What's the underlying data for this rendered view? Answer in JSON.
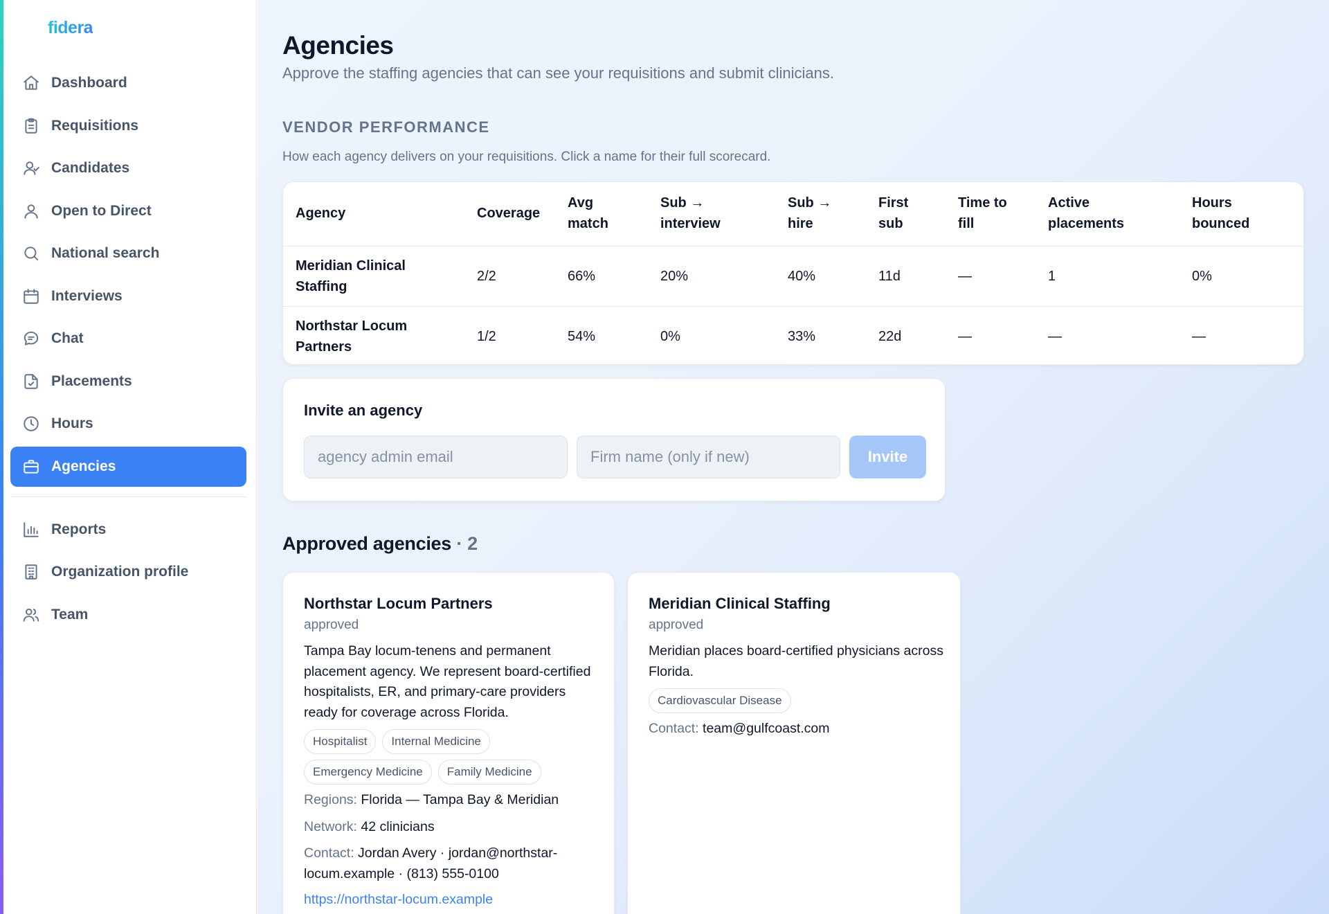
{
  "app": {
    "logo": "fidera"
  },
  "sidebar": {
    "items": [
      {
        "label": "Dashboard",
        "icon": "home-icon",
        "active": false
      },
      {
        "label": "Requisitions",
        "icon": "clipboard-icon",
        "active": false
      },
      {
        "label": "Candidates",
        "icon": "user-check-icon",
        "active": false
      },
      {
        "label": "Open to Direct",
        "icon": "user-icon",
        "active": false
      },
      {
        "label": "National search",
        "icon": "search-icon",
        "active": false
      },
      {
        "label": "Interviews",
        "icon": "calendar-icon",
        "active": false
      },
      {
        "label": "Chat",
        "icon": "chat-icon",
        "active": false
      },
      {
        "label": "Placements",
        "icon": "file-check-icon",
        "active": false
      },
      {
        "label": "Hours",
        "icon": "clock-icon",
        "active": false
      },
      {
        "label": "Agencies",
        "icon": "briefcase-icon",
        "active": true
      }
    ],
    "secondary_items": [
      {
        "label": "Reports",
        "icon": "bar-chart-icon"
      },
      {
        "label": "Organization profile",
        "icon": "building-icon"
      },
      {
        "label": "Team",
        "icon": "users-icon"
      }
    ]
  },
  "page": {
    "title": "Agencies",
    "subtitle": "Approve the staffing agencies that can see your requisitions and submit clinicians."
  },
  "vendor_performance": {
    "label": "VENDOR PERFORMANCE",
    "description": "How each agency delivers on your requisitions. Click a name for their full scorecard.",
    "headers": [
      "Agency",
      "Coverage",
      "Avg match",
      "Sub → interview",
      "Sub → hire",
      "First sub",
      "Time to fill",
      "Active placements",
      "Hours bounced"
    ],
    "rows": [
      [
        "Meridian Clinical Staffing",
        "2/2",
        "66%",
        "20%",
        "40%",
        "11d",
        "—",
        "1",
        "0%"
      ],
      [
        "Northstar Locum Partners",
        "1/2",
        "54%",
        "0%",
        "33%",
        "22d",
        "—",
        "—",
        "—"
      ]
    ]
  },
  "invite": {
    "title": "Invite an agency",
    "email_placeholder": "agency admin email",
    "email_value": "",
    "firm_placeholder": "Firm name (only if new)",
    "firm_value": "",
    "button_label": "Invite"
  },
  "approved": {
    "heading": "Approved agencies",
    "count": "· 2",
    "cards": [
      {
        "name": "Northstar Locum Partners",
        "status": "approved",
        "description": "Tampa Bay locum-tenens and permanent placement agency. We represent board-certified hospitalists, ER, and primary-care providers ready for coverage across Florida.",
        "tags": [
          "Hospitalist",
          "Internal Medicine",
          "Emergency Medicine",
          "Family Medicine"
        ],
        "regions_label": "Regions:",
        "regions": "Florida — Tampa Bay & Meridian",
        "network_label": "Network:",
        "network": "42 clinicians",
        "contact_label": "Contact:",
        "contact": "Jordan Avery · jordan@northstar-locum.example · (813) 555-0100",
        "website": "https://northstar-locum.example"
      },
      {
        "name": "Meridian Clinical Staffing",
        "status": "approved",
        "description": "Meridian places board-certified physicians across Florida.",
        "tags": [
          "Cardiovascular Disease"
        ],
        "contact_label": "Contact:",
        "contact": "team@gulfcoast.com"
      }
    ]
  },
  "colors": {
    "accent": "#3b82f6",
    "muted_text": "#64748b",
    "invite_button_disabled": "#a5c6f9"
  }
}
